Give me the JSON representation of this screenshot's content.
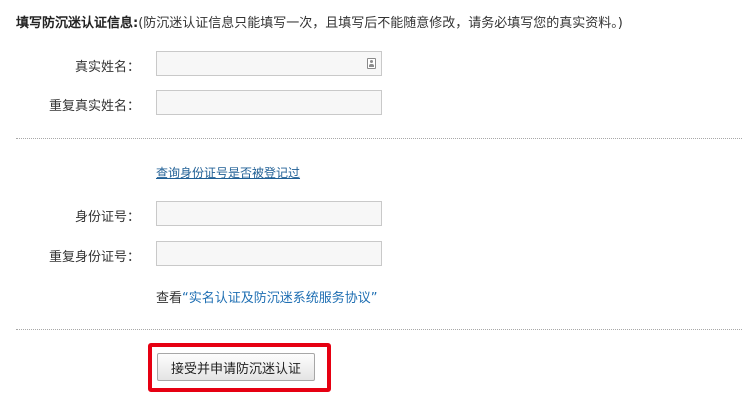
{
  "header": {
    "title": "填写防沉迷认证信息:",
    "note": "(防沉迷认证信息只能填写一次，且填写后不能随意修改，请务必填写您的真实资料。)"
  },
  "form": {
    "real_name_label": "真实姓名：",
    "real_name_value": "",
    "repeat_real_name_label": "重复真实姓名：",
    "repeat_real_name_value": "",
    "query_link": "查询身份证号是否被登记过",
    "id_number_label": "身份证号：",
    "id_number_value": "",
    "repeat_id_number_label": "重复身份证号：",
    "repeat_id_number_value": ""
  },
  "agreement": {
    "prefix": "查看",
    "link": "“实名认证及防沉迷系统服务协议”"
  },
  "submit": {
    "label": "接受并申请防沉迷认证"
  },
  "icons": {
    "contact_card": "contact-card-icon"
  },
  "colors": {
    "link": "#1f6fb3",
    "highlight": "#e60012"
  }
}
